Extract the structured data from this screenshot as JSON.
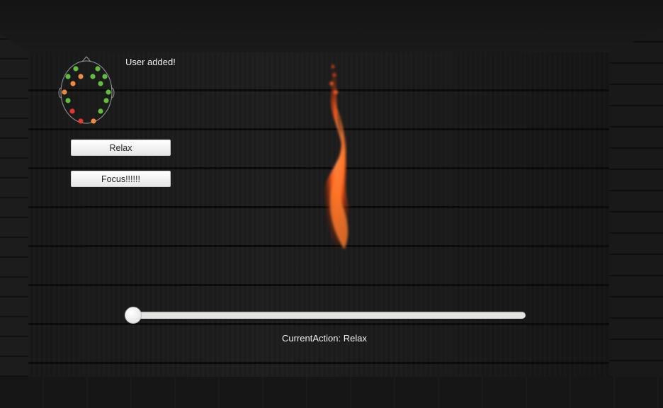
{
  "status": {
    "message": "User added!"
  },
  "buttons": {
    "relax_label": "Relax",
    "focus_label": "Focus!!!!!!"
  },
  "slider": {
    "value": 0
  },
  "current_action": {
    "text": "CurrentAction: Relax"
  },
  "headset": {
    "icon": "eeg-headset-icon",
    "sensor_colors": {
      "good": "#5fbf3a",
      "fair": "#f08a3c",
      "poor": "#e03a2a"
    },
    "sensors": [
      {
        "id": 1,
        "quality": "good"
      },
      {
        "id": 2,
        "quality": "good"
      },
      {
        "id": 3,
        "quality": "good"
      },
      {
        "id": 4,
        "quality": "fair"
      },
      {
        "id": 5,
        "quality": "good"
      },
      {
        "id": 6,
        "quality": "good"
      },
      {
        "id": 7,
        "quality": "fair"
      },
      {
        "id": 8,
        "quality": "good"
      },
      {
        "id": 9,
        "quality": "fair"
      },
      {
        "id": 10,
        "quality": "good"
      },
      {
        "id": 11,
        "quality": "good"
      },
      {
        "id": 12,
        "quality": "good"
      },
      {
        "id": 13,
        "quality": "poor"
      },
      {
        "id": 14,
        "quality": "good"
      },
      {
        "id": 15,
        "quality": "poor"
      },
      {
        "id": 16,
        "quality": "fair"
      }
    ]
  },
  "scene": {
    "flame_color": "#ff5a1a"
  }
}
